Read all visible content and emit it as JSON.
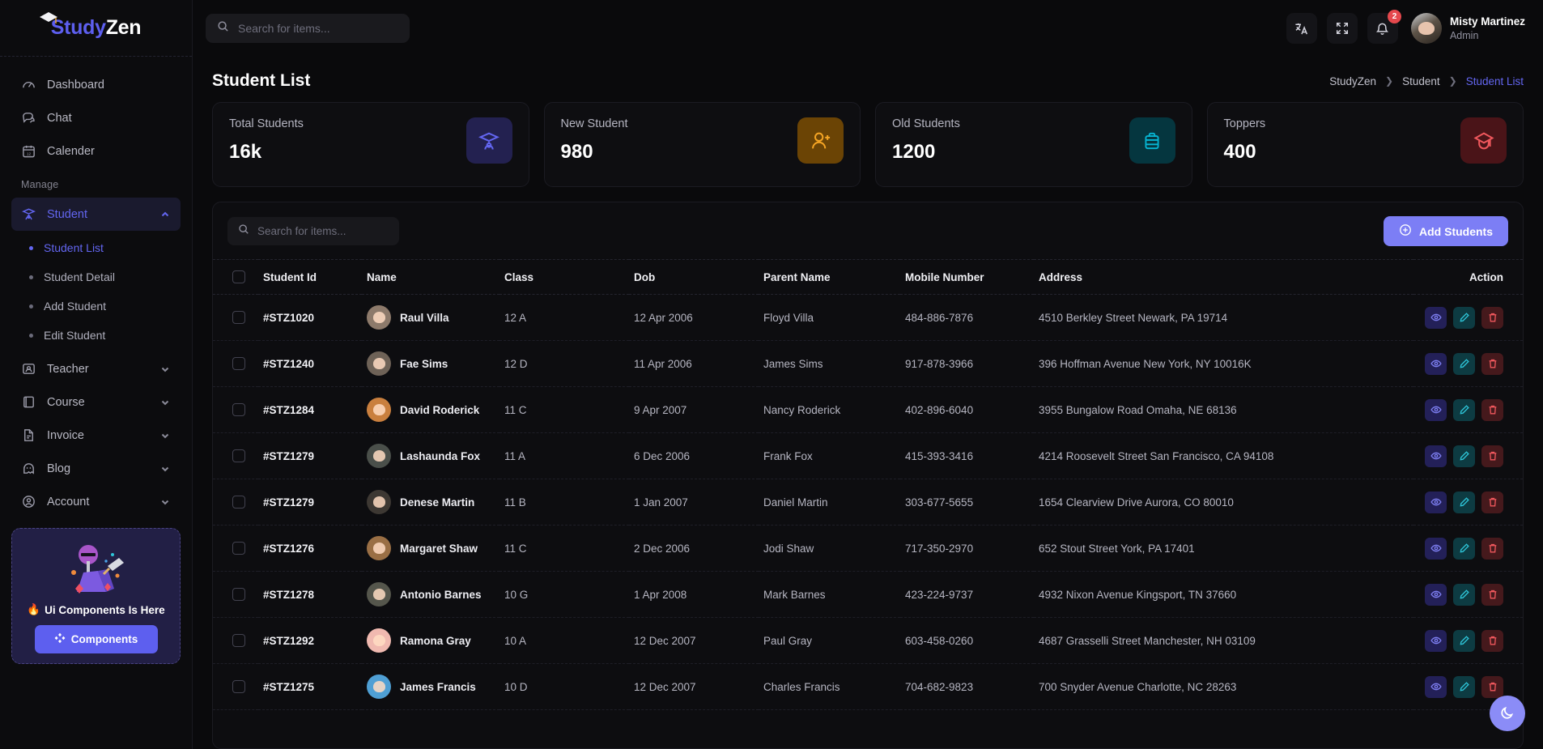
{
  "brand": {
    "name_part1": "Study",
    "name_part2": "Zen",
    "cap_icon": "graduation-cap-icon"
  },
  "topbar": {
    "search_placeholder": "Search for items...",
    "search_value": "",
    "translate_icon": "translate-icon",
    "fullscreen_icon": "fullscreen-icon",
    "notification_icon": "bell-icon",
    "notification_count": "2",
    "user_name": "Misty Martinez",
    "user_role": "Admin"
  },
  "sidebar": {
    "top_items": [
      {
        "label": "Dashboard",
        "icon": "dashboard-icon"
      },
      {
        "label": "Chat",
        "icon": "chat-icon"
      },
      {
        "label": "Calender",
        "icon": "calendar-icon"
      }
    ],
    "section_label": "Manage",
    "manage_items": [
      {
        "label": "Student",
        "icon": "student-cap-icon",
        "active": true,
        "expanded": true
      },
      {
        "label": "Teacher",
        "icon": "teacher-icon",
        "active": false,
        "expanded": false
      },
      {
        "label": "Course",
        "icon": "book-icon",
        "active": false,
        "expanded": false
      },
      {
        "label": "Invoice",
        "icon": "file-icon",
        "active": false,
        "expanded": false
      },
      {
        "label": "Blog",
        "icon": "ghost-icon",
        "active": false,
        "expanded": false
      },
      {
        "label": "Account",
        "icon": "user-circle-icon",
        "active": false,
        "expanded": false
      }
    ],
    "student_submenu": [
      {
        "label": "Student List",
        "active": true
      },
      {
        "label": "Student Detail",
        "active": false
      },
      {
        "label": "Add Student",
        "active": false
      },
      {
        "label": "Edit Student",
        "active": false
      }
    ],
    "promo": {
      "title": "Ui Components Is Here",
      "fire_icon": "fire-icon",
      "button_label": "Components",
      "button_icon": "components-icon",
      "art_icon": "mining-illustration"
    }
  },
  "page": {
    "title": "Student List",
    "breadcrumb": [
      {
        "label": "StudyZen",
        "current": false
      },
      {
        "label": "Student",
        "current": false
      },
      {
        "label": "Student List",
        "current": true
      }
    ]
  },
  "stats": [
    {
      "label": "Total Students",
      "value": "16k",
      "icon": "student-cap-icon",
      "icon_color": "#6366f1",
      "icon_bg": "#232150"
    },
    {
      "label": "New Student",
      "value": "980",
      "icon": "user-plus-icon",
      "icon_color": "#f5a524",
      "icon_bg": "#6b4405"
    },
    {
      "label": "Old Students",
      "value": "1200",
      "icon": "briefcase-icon",
      "icon_color": "#06b6d4",
      "icon_bg": "#05363f"
    },
    {
      "label": "Toppers",
      "value": "400",
      "icon": "graduation-cap-icon",
      "icon_color": "#f0585d",
      "icon_bg": "#4a1418"
    }
  ],
  "table": {
    "search_placeholder": "Search for items...",
    "search_value": "",
    "add_button_label": "Add Students",
    "add_button_icon": "plus-circle-icon",
    "columns": [
      "Student Id",
      "Name",
      "Class",
      "Dob",
      "Parent Name",
      "Mobile Number",
      "Address",
      "Action"
    ],
    "action_icons": [
      "eye-icon",
      "pencil-icon",
      "trash-icon"
    ],
    "rows": [
      {
        "id": "#STZ1020",
        "name": "Raul Villa",
        "class": "12 A",
        "dob": "12 Apr 2006",
        "parent": "Floyd Villa",
        "mobile": "484-886-7876",
        "address": "4510 Berkley Street Newark, PA 19714",
        "avatar_color": "#8d7a6b"
      },
      {
        "id": "#STZ1240",
        "name": "Fae Sims",
        "class": "12 D",
        "dob": "11 Apr 2006",
        "parent": "James Sims",
        "mobile": "917-878-3966",
        "address": "396 Hoffman Avenue New York, NY 10016K",
        "avatar_color": "#6e6257"
      },
      {
        "id": "#STZ1284",
        "name": "David Roderick",
        "class": "11 C",
        "dob": "9 Apr 2007",
        "parent": "Nancy Roderick",
        "mobile": "402-896-6040",
        "address": "3955 Bungalow Road Omaha, NE 68136",
        "avatar_color": "#c97f3e"
      },
      {
        "id": "#STZ1279",
        "name": "Lashaunda Fox",
        "class": "11 A",
        "dob": "6 Dec 2006",
        "parent": "Frank Fox",
        "mobile": "415-393-3416",
        "address": "4214 Roosevelt Street San Francisco, CA 94108",
        "avatar_color": "#4a4f4a"
      },
      {
        "id": "#STZ1279",
        "name": "Denese Martin",
        "class": "11 B",
        "dob": "1 Jan 2007",
        "parent": "Daniel Martin",
        "mobile": "303-677-5655",
        "address": "1654 Clearview Drive Aurora, CO 80010",
        "avatar_color": "#3d3833"
      },
      {
        "id": "#STZ1276",
        "name": "Margaret Shaw",
        "class": "11 C",
        "dob": "2 Dec 2006",
        "parent": "Jodi Shaw",
        "mobile": "717-350-2970",
        "address": "652 Stout Street York, PA 17401",
        "avatar_color": "#9a6f45"
      },
      {
        "id": "#STZ1278",
        "name": "Antonio Barnes",
        "class": "10 G",
        "dob": "1 Apr 2008",
        "parent": "Mark Barnes",
        "mobile": "423-224-9737",
        "address": "4932 Nixon Avenue Kingsport, TN 37660",
        "avatar_color": "#55564c"
      },
      {
        "id": "#STZ1292",
        "name": "Ramona Gray",
        "class": "10 A",
        "dob": "12 Dec 2007",
        "parent": "Paul Gray",
        "mobile": "603-458-0260",
        "address": "4687 Grasselli Street Manchester, NH 03109",
        "avatar_color": "#f0b9b0"
      },
      {
        "id": "#STZ1275",
        "name": "James Francis",
        "class": "10 D",
        "dob": "12 Dec 2007",
        "parent": "Charles Francis",
        "mobile": "704-682-9823",
        "address": "700 Snyder Avenue Charlotte, NC 28263",
        "avatar_color": "#4f9fd4"
      }
    ]
  },
  "fab": {
    "icon": "moon-icon"
  },
  "colors": {
    "accent": "#6366f1",
    "accent_button": "#7c7ef5",
    "danger": "#f0585d",
    "teal": "#2ec5d8"
  }
}
